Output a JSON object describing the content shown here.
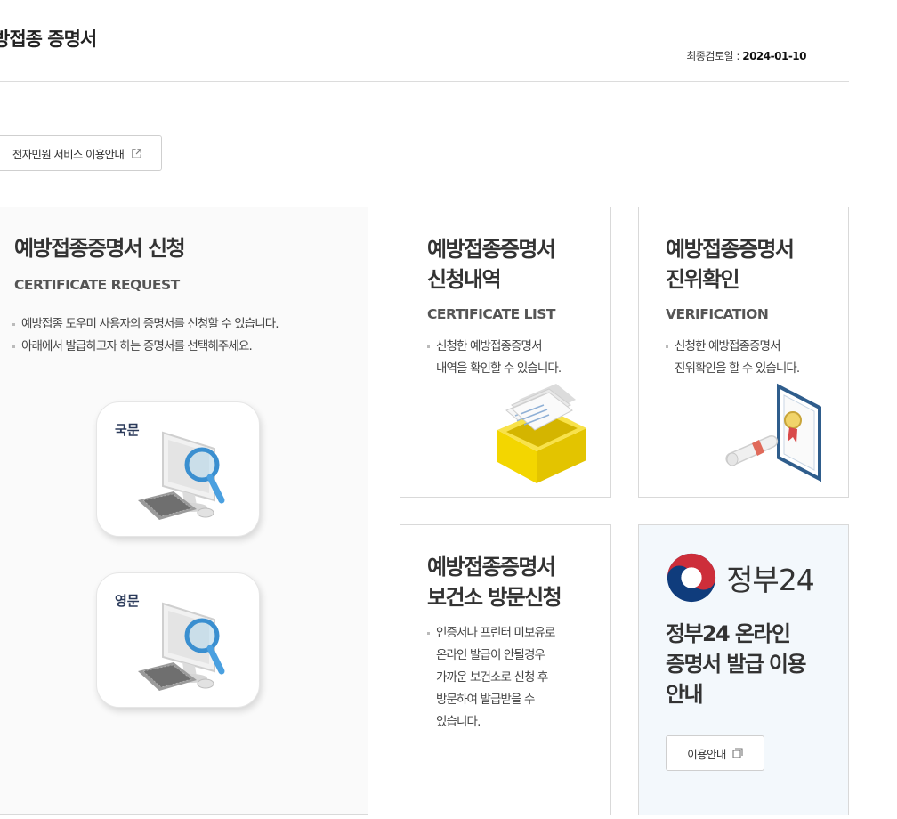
{
  "header": {
    "title": "방접종 증명서",
    "review_label": "최종검토일 : ",
    "review_date": "2024-01-10"
  },
  "guide_button": {
    "label": "전자민원 서비스 이용안내",
    "icon": "external-link-icon"
  },
  "request_card": {
    "title": "예방접종증명서 신청",
    "subtitle": "CERTIFICATE REQUEST",
    "desc": [
      "예방접종 도우미 사용자의 증명서를 신청할 수 있습니다.",
      "아래에서 발급하고자 하는 증명서를 선택해주세요."
    ],
    "korean_label": "국문",
    "english_label": "영문"
  },
  "list_card": {
    "title_lines": [
      "예방접종증명서",
      "신청내역"
    ],
    "subtitle": "CERTIFICATE LIST",
    "desc_lines": [
      "신청한 예방접종증명서",
      "내역을 확인할 수 있습니다."
    ]
  },
  "verify_card": {
    "title_lines": [
      "예방접종증명서",
      "진위확인"
    ],
    "subtitle": "VERIFICATION",
    "desc_lines": [
      "신청한 예방접종증명서",
      "진위확인을 할 수 있습니다."
    ]
  },
  "visit_card": {
    "title_lines": [
      "예방접종증명서",
      "보건소 방문신청"
    ],
    "desc_lines": [
      "인증서나 프린터 미보유로",
      "온라인 발급이 안될경우",
      "가까운 보건소로 신청 후",
      "방문하여 발급받을 수",
      "있습니다."
    ]
  },
  "gov24_card": {
    "logo_text": "정부24",
    "title_lines": [
      "정부24 온라인",
      "증명서 발급 이용",
      "안내"
    ],
    "button_label": "이용안내",
    "button_icon": "new-window-icon"
  },
  "colors": {
    "gov_red": "#cd2e3a",
    "gov_blue": "#0f3c7c",
    "folder_yellow": "#f6d800",
    "gov24_bg": "#f3f8fc"
  }
}
